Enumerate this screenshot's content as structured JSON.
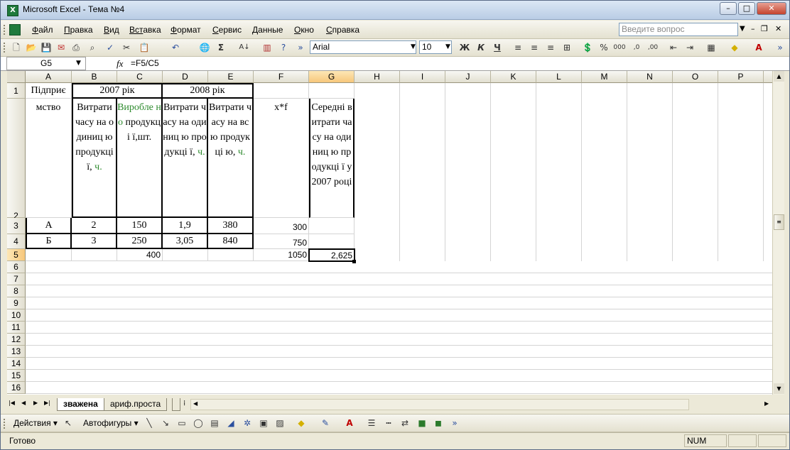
{
  "window": {
    "title": "Microsoft Excel - Тема №4",
    "app_icon": "X"
  },
  "menu": {
    "items": [
      {
        "first": "Ф",
        "rest": "айл"
      },
      {
        "first": "П",
        "rest": "равка"
      },
      {
        "first": "В",
        "rest": "ид"
      },
      {
        "first": "Вст",
        "rest": "авка"
      },
      {
        "first": "Ф",
        "rest": "ормат"
      },
      {
        "first": "С",
        "rest": "ервис"
      },
      {
        "first": "Д",
        "rest": "анные"
      },
      {
        "first": "О",
        "rest": "кно"
      },
      {
        "first": "С",
        "rest": "правка"
      }
    ],
    "help_placeholder": "Введите вопрос"
  },
  "toolbar": {
    "font": "Arial",
    "size": "10",
    "bold": "Ж",
    "italic": "К",
    "underline": "Ч",
    "sum": "Σ",
    "percent": "%",
    "thousands": "000"
  },
  "formula": {
    "name_box": "G5",
    "fx": "fx",
    "content": "=F5/C5"
  },
  "columns": [
    "A",
    "B",
    "C",
    "D",
    "E",
    "F",
    "G",
    "H",
    "I",
    "J",
    "K",
    "L",
    "M",
    "N",
    "O",
    "P"
  ],
  "rows": [
    "1",
    "2",
    "3",
    "4",
    "5",
    "6",
    "7",
    "8",
    "9",
    "10",
    "11",
    "12",
    "13",
    "14",
    "15",
    "16"
  ],
  "cells": {
    "a1": "Підприє",
    "b1": "2007 рік",
    "d1": "2008 рік",
    "a2": "мство",
    "b2a": "Витрати часу на одиниц ю продукці ї,",
    "b2b": "ч.",
    "c2a": "Виробле но",
    "c2b": "продукці ї,шт.",
    "d2a": "Витрати часу на одиниц ю продукці ї,",
    "d2b": "ч.",
    "e2a": "Витрати часу на всю продукці ю,",
    "e2b": "ч.",
    "f2": "x*f",
    "g2": "Середні витрати часу на одиниц ю продукці ї у 2007 році",
    "a3": "А",
    "b3": "2",
    "c3": "150",
    "d3": "1,9",
    "e3": "380",
    "f3": "300",
    "a4": "Б",
    "b4": "3",
    "c4": "250",
    "d4": "3,05",
    "e4": "840",
    "f4": "750",
    "c5": "400",
    "f5": "1050",
    "g5": "2,625"
  },
  "sheets": {
    "active": "зважена",
    "other": "ариф.проста"
  },
  "drawing": {
    "actions": "Действия",
    "autoshapes": "Автофигуры"
  },
  "status": {
    "left": "Готово",
    "num": "NUM"
  }
}
